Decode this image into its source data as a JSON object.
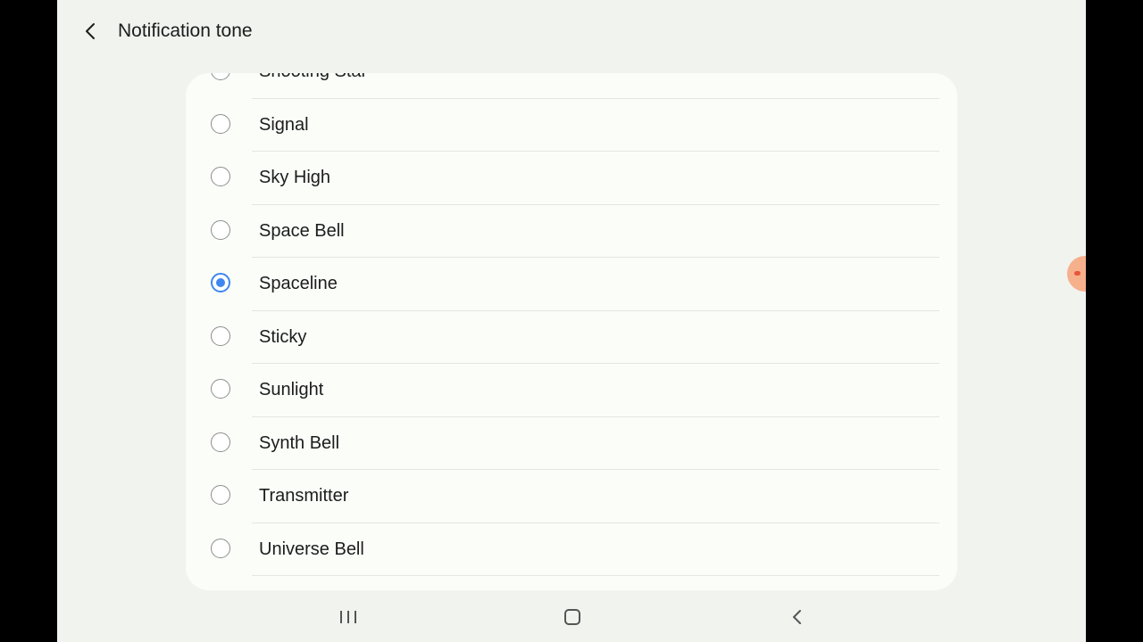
{
  "header": {
    "title": "Notification tone"
  },
  "tones": [
    {
      "label": "Shooting Star",
      "selected": false
    },
    {
      "label": "Signal",
      "selected": false
    },
    {
      "label": "Sky High",
      "selected": false
    },
    {
      "label": "Space Bell",
      "selected": false
    },
    {
      "label": "Spaceline",
      "selected": true
    },
    {
      "label": "Sticky",
      "selected": false
    },
    {
      "label": "Sunlight",
      "selected": false
    },
    {
      "label": "Synth Bell",
      "selected": false
    },
    {
      "label": "Transmitter",
      "selected": false
    },
    {
      "label": "Universe Bell",
      "selected": false
    },
    {
      "label": "",
      "selected": false
    }
  ],
  "colors": {
    "accent": "#3e87f0",
    "background": "#f1f3ef",
    "card": "#fbfdf9"
  },
  "navbar": {
    "icons": [
      "recent-apps-icon",
      "home-icon",
      "back-icon"
    ]
  }
}
